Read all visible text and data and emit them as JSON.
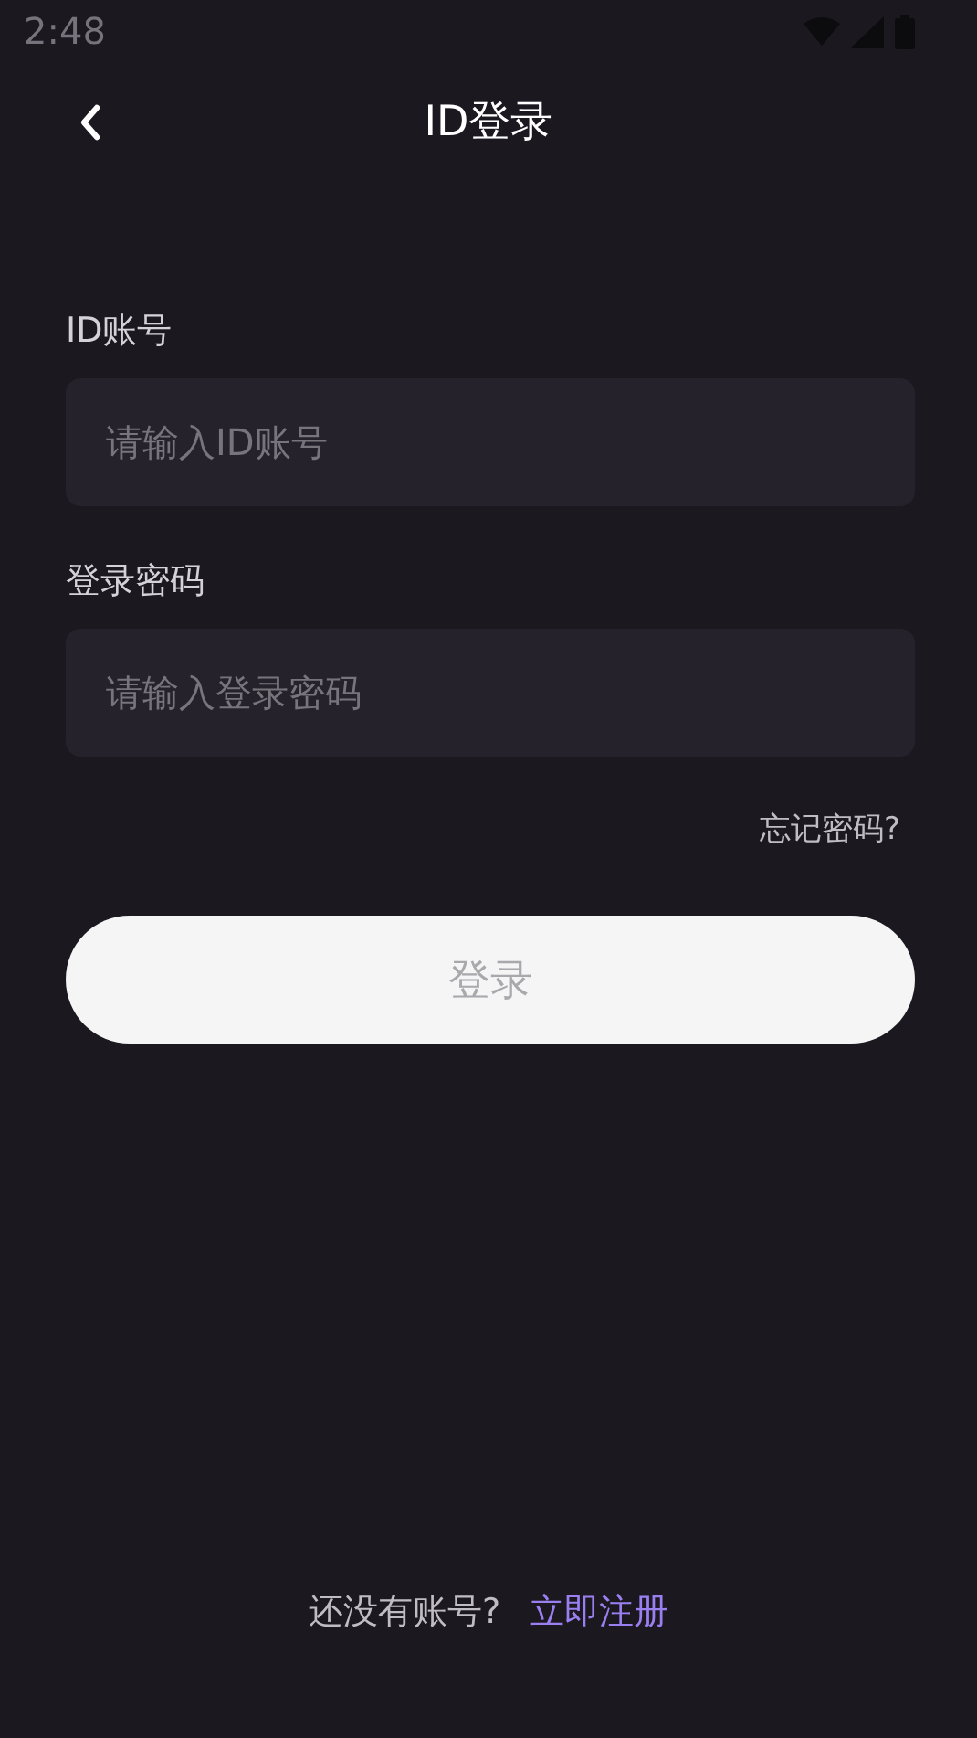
{
  "status_bar": {
    "time": "2:48"
  },
  "header": {
    "title": "ID登录"
  },
  "fields": [
    {
      "label": "ID账号",
      "placeholder": "请输入ID账号"
    },
    {
      "label": "登录密码",
      "placeholder": "请输入登录密码"
    }
  ],
  "forgot_link": "忘记密码?",
  "login_button": {
    "label": "登录",
    "disabled": true
  },
  "footer": {
    "prompt": "还没有账号?",
    "link": "立即注册"
  }
}
